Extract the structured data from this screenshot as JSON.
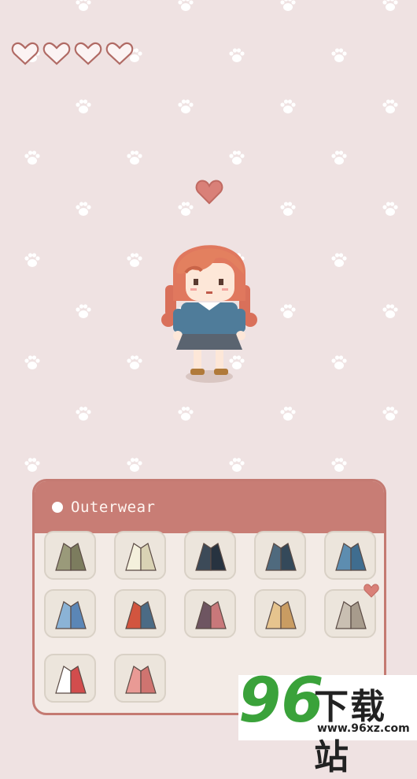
{
  "hud": {
    "hearts_total": 4,
    "hearts_filled": 0
  },
  "wardrobe": {
    "category": "Outerwear",
    "items": [
      {
        "name": "olive-coat",
        "colors": [
          "#9a9a7a",
          "#7c7c5e"
        ]
      },
      {
        "name": "cream-cape",
        "colors": [
          "#f4f0dc",
          "#d9d2b4"
        ]
      },
      {
        "name": "navy-coat",
        "colors": [
          "#3c4a58",
          "#273340"
        ]
      },
      {
        "name": "slate-blue-coat",
        "colors": [
          "#4f6a7e",
          "#34495a"
        ]
      },
      {
        "name": "blue-jacket",
        "colors": [
          "#5d8db0",
          "#3f6d8f"
        ]
      },
      {
        "name": "sky-blue-cape",
        "colors": [
          "#8bb3d6",
          "#5b86b6"
        ]
      },
      {
        "name": "red-plaid-coat",
        "colors": [
          "#d2553f",
          "#4b6b85"
        ]
      },
      {
        "name": "plum-coat",
        "colors": [
          "#6e5561",
          "#c8787a"
        ]
      },
      {
        "name": "tan-coat",
        "colors": [
          "#e6c48e",
          "#c99c62"
        ]
      },
      {
        "name": "grey-trench",
        "colors": [
          "#c9bfb2",
          "#a79b8c"
        ]
      },
      {
        "name": "sailor-cape",
        "colors": [
          "#ffffff",
          "#d24d4d"
        ]
      },
      {
        "name": "pink-coat",
        "colors": [
          "#e99a95",
          "#cf7470"
        ]
      }
    ]
  },
  "watermark": {
    "number": "96",
    "chinese": "下载站",
    "url": "www.96xz.com"
  }
}
